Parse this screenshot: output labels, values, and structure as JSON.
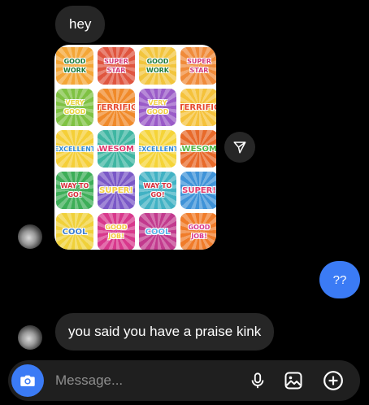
{
  "thread": {
    "messages": [
      {
        "sender": "them",
        "type": "text",
        "text": "hey"
      },
      {
        "sender": "them",
        "type": "image",
        "alt": "",
        "stickers": [
          {
            "label": "GOOD WORK",
            "bg": "#f4a636",
            "color": "#1e7a3a"
          },
          {
            "label": "SUPER STAR",
            "bg": "#e0553f",
            "color": "#d13b7a"
          },
          {
            "label": "GOOD WORK",
            "bg": "#f2c53d",
            "color": "#1e7a3a"
          },
          {
            "label": "SUPER STAR",
            "bg": "#f08b3a",
            "color": "#d13b7a"
          },
          {
            "label": "VERY GOOD",
            "bg": "#7fc243",
            "color": "#e8d33c"
          },
          {
            "label": "TERRIFIC",
            "bg": "#f08a2a",
            "color": "#e64a2e"
          },
          {
            "label": "VERY GOOD",
            "bg": "#9a5bc8",
            "color": "#f2cf45"
          },
          {
            "label": "TERRIFIC",
            "bg": "#f5c23b",
            "color": "#e64a2e"
          },
          {
            "label": "EXCELLENT",
            "bg": "#f5cf38",
            "color": "#2f8ad6"
          },
          {
            "label": "AWESOME",
            "bg": "#3fb6a2",
            "color": "#e0396e"
          },
          {
            "label": "EXCELLENT",
            "bg": "#f5d438",
            "color": "#2f8ad6"
          },
          {
            "label": "AWESOME",
            "bg": "#e86a2a",
            "color": "#53b84a"
          },
          {
            "label": "WAY TO GO!",
            "bg": "#3dae58",
            "color": "#d82c3a"
          },
          {
            "label": "SUPER!",
            "bg": "#7a58c7",
            "color": "#f4d040"
          },
          {
            "label": "WAY TO GO!",
            "bg": "#41b2c4",
            "color": "#d82c3a"
          },
          {
            "label": "SUPER!",
            "bg": "#3f93d8",
            "color": "#e23a6c"
          },
          {
            "label": "COOL",
            "bg": "#f0d13a",
            "color": "#3d7fd0"
          },
          {
            "label": "GOOD JOB!",
            "bg": "#d8388c",
            "color": "#f3c73e"
          },
          {
            "label": "COOL",
            "bg": "#c23a8e",
            "color": "#5ab3ea"
          },
          {
            "label": "GOOD JOB!",
            "bg": "#f07c2a",
            "color": "#d8388c"
          }
        ]
      },
      {
        "sender": "me",
        "type": "text",
        "text": "??"
      },
      {
        "sender": "them",
        "type": "text",
        "text": "you said you have a praise kink"
      }
    ]
  },
  "composer": {
    "placeholder": "Message...",
    "icons": [
      "camera-icon",
      "microphone-icon",
      "gallery-icon",
      "plus-circle-icon"
    ]
  },
  "colors": {
    "background": "#000000",
    "incoming_bubble": "#262626",
    "outgoing_bubble": "#3b7bf5",
    "placeholder": "#8e8e8e"
  }
}
